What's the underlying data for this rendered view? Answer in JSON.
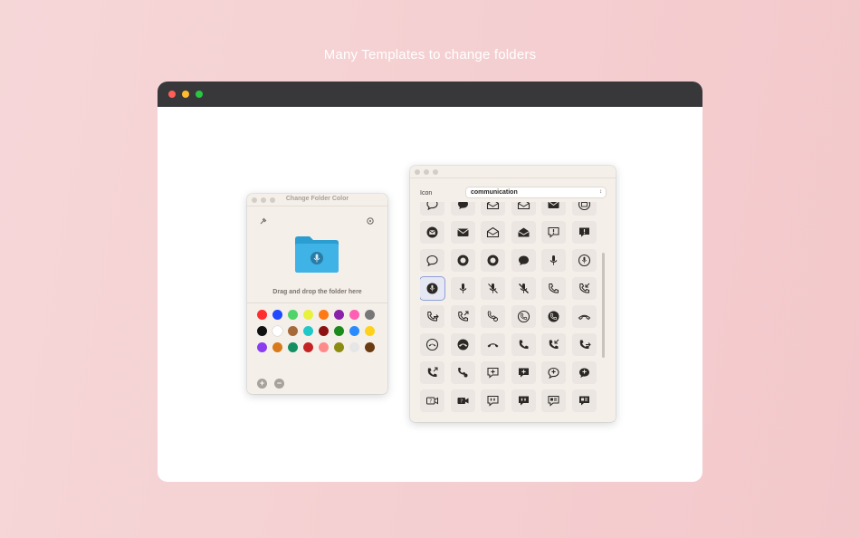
{
  "headline": "Many Templates to change folders",
  "left_window": {
    "title": "Change Folder Color",
    "drop_label": "Drag and drop the folder here",
    "add_label": "+",
    "remove_label": "−",
    "folder_color": "#3fb3e6",
    "swatch_colors": [
      "#ff2d2d",
      "#1e49ff",
      "#4fd36a",
      "#e8f13b",
      "#ff7a14",
      "#8b21a8",
      "#ff5fb3",
      "#777777",
      "#111111",
      "#ffffff",
      "#a66a3a",
      "#20c8c8",
      "#8c1111",
      "#1d8a1d",
      "#2a8bff",
      "#ffd11a",
      "#8a3cf0",
      "#d97a1a",
      "#138f62",
      "#c52424",
      "#ff8a8a",
      "#8c8c12",
      "#e6e6e6",
      "#6a3a10"
    ]
  },
  "right_window": {
    "icon_label": "Icon",
    "category_value": "communication",
    "icons": [
      "bubble-left-icon",
      "bubble-fill-icon",
      "envelope-open-icon",
      "envelope-open-icon",
      "envelope-fill-icon",
      "envelope-circle-icon",
      "envelope-circle-fill-icon",
      "envelope-fill-icon",
      "envelope-open-icon",
      "envelope-open-fill-icon",
      "exclamation-bubble-icon",
      "exclamation-bubble-fill-icon",
      "bubble-left-icon",
      "bubble-circle-fill-icon",
      "bubble-circle-fill-icon",
      "bubble-fill-icon",
      "mic-icon",
      "mic-circle-icon",
      "mic-circle-fill-icon",
      "mic-icon",
      "mic-slash-icon",
      "mic-slash-fill-icon",
      "phone-icon",
      "phone-arrow-down-left-icon",
      "phone-arrow-right-icon",
      "phone-arrow-up-right-icon",
      "phone-connection-icon",
      "phone-circle-icon",
      "phone-circle-fill-icon",
      "phone-down-icon",
      "phone-down-circle-icon",
      "phone-down-circle-fill-icon",
      "phone-down-fill-icon",
      "phone-fill-icon",
      "phone-arrow-down-left-fill-icon",
      "phone-arrow-right-fill-icon",
      "phone-arrow-up-right-fill-icon",
      "phone-connection-fill-icon",
      "plus-bubble-icon",
      "plus-bubble-fill-icon",
      "plus-bubble-round-icon",
      "plus-bubble-round-fill-icon",
      "video-question-icon",
      "video-question-fill-icon",
      "quote-bubble-icon",
      "quote-bubble-fill-icon",
      "text-bubble-icon",
      "text-bubble-fill-icon"
    ],
    "selected_icon_index": 18
  }
}
